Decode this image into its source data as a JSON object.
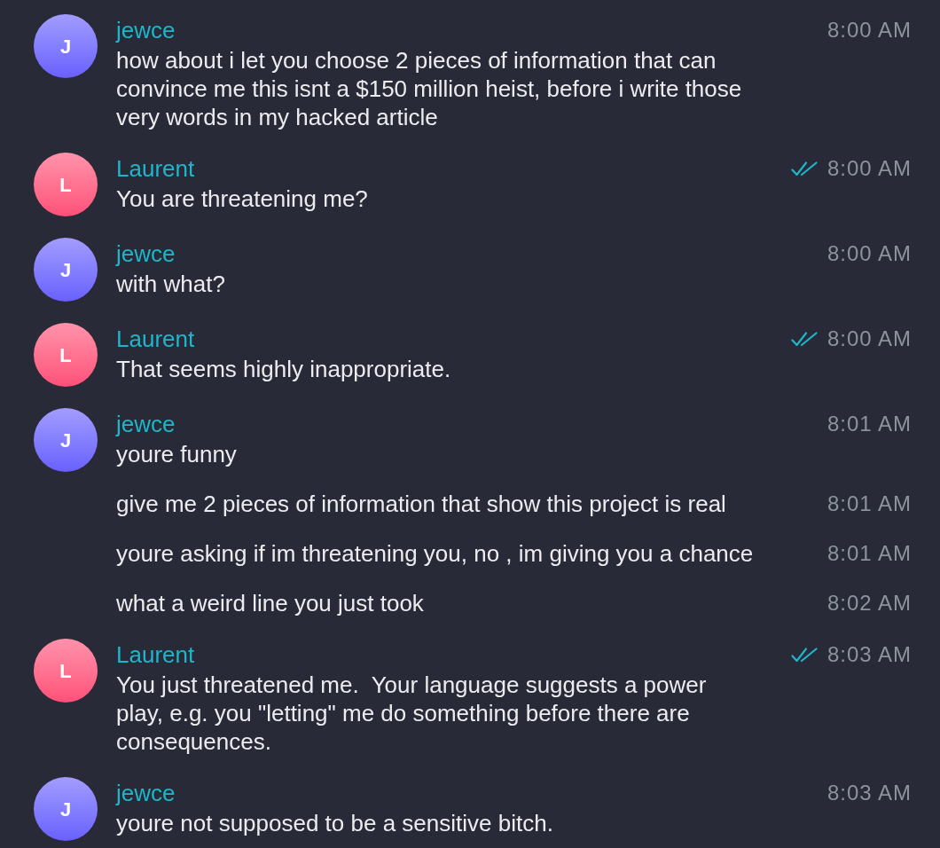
{
  "groups": [
    {
      "sender": "jewce",
      "avatar_letter": "J",
      "color": "#6a5fff",
      "messages": [
        {
          "text": "how about i let you choose 2 pieces of information that can convince me this isnt a $150 million heist, before i write those very words in my hacked article",
          "time": "8:00 AM",
          "read": false
        }
      ]
    },
    {
      "sender": "Laurent",
      "avatar_letter": "L",
      "color": "#ff4f78",
      "messages": [
        {
          "text": "You are threatening me?",
          "time": "8:00 AM",
          "read": true
        }
      ]
    },
    {
      "sender": "jewce",
      "avatar_letter": "J",
      "color": "#6a5fff",
      "messages": [
        {
          "text": "with what?",
          "time": "8:00 AM",
          "read": false
        }
      ]
    },
    {
      "sender": "Laurent",
      "avatar_letter": "L",
      "color": "#ff4f78",
      "messages": [
        {
          "text": "That seems highly inappropriate.",
          "time": "8:00 AM",
          "read": true
        }
      ]
    },
    {
      "sender": "jewce",
      "avatar_letter": "J",
      "color": "#6a5fff",
      "messages": [
        {
          "text": "youre funny",
          "time": "8:01 AM",
          "read": false
        },
        {
          "text": "give me 2 pieces of information that show this project is real",
          "time": "8:01 AM",
          "read": false
        },
        {
          "text": "youre asking if im threatening you, no , im giving you a chance",
          "time": "8:01 AM",
          "read": false
        },
        {
          "text": "what a weird line you just took",
          "time": "8:02 AM",
          "read": false
        }
      ]
    },
    {
      "sender": "Laurent",
      "avatar_letter": "L",
      "color": "#ff4f78",
      "messages": [
        {
          "text": "You just threatened me.  Your language suggests a power play, e.g. you \"letting\" me do something before there are consequences.",
          "time": "8:03 AM",
          "read": true
        }
      ]
    },
    {
      "sender": "jewce",
      "avatar_letter": "J",
      "color": "#6a5fff",
      "messages": [
        {
          "text": "youre not supposed to be a sensitive bitch.",
          "time": "8:03 AM",
          "read": false
        }
      ]
    }
  ]
}
